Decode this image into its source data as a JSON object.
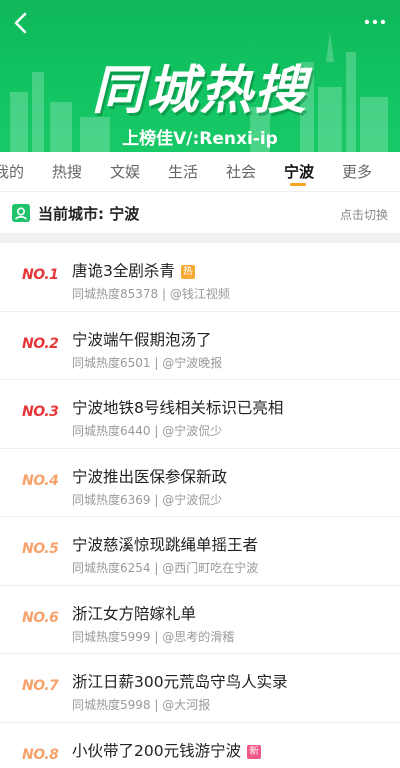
{
  "banner": {
    "title": "同城热搜",
    "subtitle": "上榜佳V/:Renxi-ip"
  },
  "tabs": [
    {
      "label": "我的",
      "active": false
    },
    {
      "label": "热搜",
      "active": false
    },
    {
      "label": "文娱",
      "active": false
    },
    {
      "label": "生活",
      "active": false
    },
    {
      "label": "社会",
      "active": false
    },
    {
      "label": "宁波",
      "active": true
    },
    {
      "label": "更多",
      "active": false
    }
  ],
  "city": {
    "label": "当前城市: 宁波",
    "switch_label": "点击切换"
  },
  "colors": {
    "brand_green": "#12c462",
    "rank_top": "#e8373a",
    "rank_low": "#f6a26a",
    "tab_underline": "#f5a623",
    "badge_hot": "#f7a933",
    "badge_new": "#f15787"
  },
  "items": [
    {
      "rank": "NO.1",
      "title": "唐诡3全剧杀青",
      "meta": "同城热度85378 | @钱江视频",
      "badge": "热"
    },
    {
      "rank": "NO.2",
      "title": "宁波端午假期泡汤了",
      "meta": "同城热度6501 | @宁波晚报",
      "badge": ""
    },
    {
      "rank": "NO.3",
      "title": "宁波地铁8号线相关标识已亮相",
      "meta": "同城热度6440 | @宁波侃少",
      "badge": ""
    },
    {
      "rank": "NO.4",
      "title": "宁波推出医保参保新政",
      "meta": "同城热度6369 | @宁波侃少",
      "badge": ""
    },
    {
      "rank": "NO.5",
      "title": "宁波慈溪惊现跳绳单摇王者",
      "meta": "同城热度6254 | @西门町吃在宁波",
      "badge": ""
    },
    {
      "rank": "NO.6",
      "title": "浙江女方陪嫁礼单",
      "meta": "同城热度5999 | @思考的滑稽",
      "badge": ""
    },
    {
      "rank": "NO.7",
      "title": "浙江日薪300元荒岛守鸟人实录",
      "meta": "同城热度5998 | @大河报",
      "badge": ""
    },
    {
      "rank": "NO.8",
      "title": "小伙带了200元钱游宁波",
      "meta": "",
      "badge": "新"
    }
  ]
}
